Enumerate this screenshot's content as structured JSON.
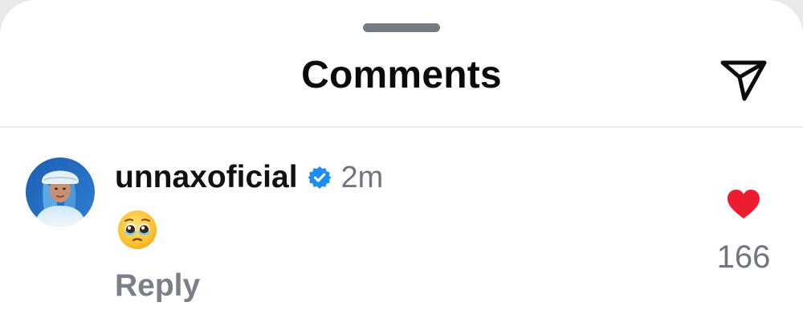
{
  "header": {
    "title": "Comments",
    "share_icon": "paper-plane-icon"
  },
  "comment": {
    "username": "unnaxoficial",
    "verified_icon": "verified-badge-icon",
    "time": "2m",
    "text": "🥹",
    "reply_label": "Reply",
    "like_icon": "heart-filled-icon",
    "like_count": "166"
  },
  "colors": {
    "heart": "#ee1c2f",
    "verified": "#1f8cf0",
    "secondary_text": "#6f7480"
  }
}
